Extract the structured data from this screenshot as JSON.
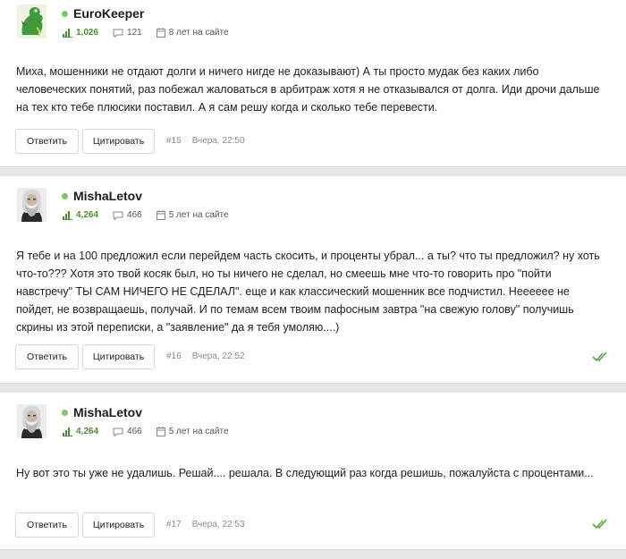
{
  "posts": [
    {
      "username": "EuroKeeper",
      "rating": "1,026",
      "comments": "121",
      "on_site": "8 лет на сайте",
      "message": "Миха, мошенники не отдают долги и ничего нигде не доказывают) А ты просто мудак без каких либо человеческих понятий, раз побежал жаловаться в арбитраж хотя я не отказывался от долга. Иди дрочи дальше на тех кто тебе плюсики поставил. А я сам решу когда и сколько тебе перевести.",
      "reply_label": "Ответить",
      "quote_label": "Цитировать",
      "number": "#15",
      "time": "Вчера, 22:50"
    },
    {
      "username": "MishaLetov",
      "rating": "4,264",
      "comments": "466",
      "on_site": "5 лет на сайте",
      "message": "Я тебе и на 100 предложил если перейдем часть скосить, и проценты убрал... а ты? что ты предложил? ну хоть что-то??? Хотя это твой косяк был, но ты ничего не сделал, но смеешь мне что-то говорить про \"пойти навстречу\" ТЫ САМ НИЧЕГО НЕ СДЕЛАЛ\". еще и как классический мошенник все подчистил. Нееееее не пойдет, не возвращаешь, получай. И по темам всем твоим пафосным завтра \"на свежую голову\" получишь скрины из этой переписки, а \"заявление\" да я тебя умоляю....)",
      "reply_label": "Ответить",
      "quote_label": "Цитировать",
      "number": "#16",
      "time": "Вчера, 22:52"
    },
    {
      "username": "MishaLetov",
      "rating": "4,264",
      "comments": "466",
      "on_site": "5 лет на сайте",
      "message": "Ну вот это ты уже не удалишь. Решай.... решала. В следующий раз когда решишь, пожалуйста с процентами...",
      "reply_label": "Ответить",
      "quote_label": "Цитировать",
      "number": "#17",
      "time": "Вчера, 22:53"
    }
  ],
  "colors": {
    "online": "#7cc85e",
    "rating": "#4e8f2e",
    "read_check": "#5aa33a"
  },
  "icons": [
    "rating-bars-icon",
    "comment-icon",
    "calendar-icon",
    "double-check-icon"
  ]
}
